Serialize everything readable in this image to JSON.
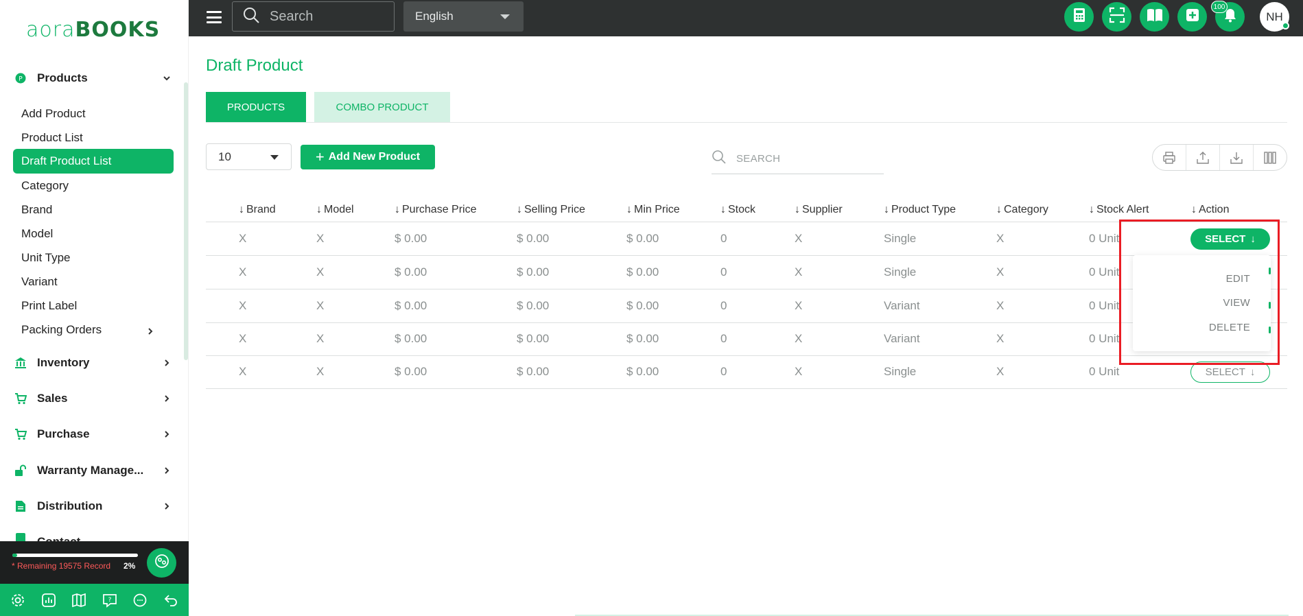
{
  "app": {
    "logo_thin": "aora",
    "logo_bold": "BOOKS"
  },
  "topbar": {
    "search_placeholder": "Search",
    "language": "English",
    "notification_count": "100",
    "user_initials": "NH",
    "icons": [
      "calculator-icon",
      "scan-icon",
      "book-icon",
      "add-icon",
      "bell-icon"
    ]
  },
  "sidebar": {
    "products_label": "Products",
    "product_items": [
      {
        "label": "Add Product"
      },
      {
        "label": "Product List"
      },
      {
        "label": "Draft Product List"
      },
      {
        "label": "Category"
      },
      {
        "label": "Brand"
      },
      {
        "label": "Model"
      },
      {
        "label": "Unit Type"
      },
      {
        "label": "Variant"
      },
      {
        "label": "Print Label"
      },
      {
        "label": "Packing Orders"
      }
    ],
    "active_item": "Draft Product List",
    "groups": [
      {
        "label": "Inventory",
        "icon": "bank-icon"
      },
      {
        "label": "Sales",
        "icon": "cart-icon"
      },
      {
        "label": "Purchase",
        "icon": "cart-icon"
      },
      {
        "label": "Warranty Manage...",
        "icon": "unlock-icon"
      },
      {
        "label": "Distribution",
        "icon": "document-icon"
      },
      {
        "label": "Contact",
        "icon": "contact-icon"
      }
    ],
    "remaining_text": "* Remaining 19575 Record",
    "progress_percent": "2%",
    "progress_value": 0.02,
    "footer_icons": [
      "settings-icon",
      "report-icon",
      "guide-icon",
      "help-icon",
      "chat-icon",
      "logout-icon"
    ]
  },
  "main": {
    "title": "Draft Product",
    "tabs": [
      {
        "label": "PRODUCTS",
        "active": true
      },
      {
        "label": "COMBO PRODUCT",
        "active": false
      }
    ],
    "page_size": "10",
    "add_button": "Add New Product",
    "search_placeholder": "SEARCH",
    "columns": [
      "Brand",
      "Model",
      "Purchase Price",
      "Selling Price",
      "Min Price",
      "Stock",
      "Supplier",
      "Product Type",
      "Category",
      "Stock Alert",
      "Action"
    ],
    "rows": [
      [
        "X",
        "X",
        "$ 0.00",
        "$ 0.00",
        "$ 0.00",
        "0",
        "X",
        "Single",
        "X",
        "0 Unit"
      ],
      [
        "X",
        "X",
        "$ 0.00",
        "$ 0.00",
        "$ 0.00",
        "0",
        "X",
        "Single",
        "X",
        "0 Unit"
      ],
      [
        "X",
        "X",
        "$ 0.00",
        "$ 0.00",
        "$ 0.00",
        "0",
        "X",
        "Variant",
        "X",
        "0 Unit"
      ],
      [
        "X",
        "X",
        "$ 0.00",
        "$ 0.00",
        "$ 0.00",
        "0",
        "X",
        "Variant",
        "X",
        "0 Unit"
      ],
      [
        "X",
        "X",
        "$ 0.00",
        "$ 0.00",
        "$ 0.00",
        "0",
        "X",
        "Single",
        "X",
        "0 Unit"
      ]
    ],
    "select_label": "SELECT",
    "dropdown_items": [
      "EDIT",
      "VIEW",
      "DELETE"
    ]
  },
  "colors": {
    "accent": "#0eb466",
    "topbar": "#2e3131",
    "highlight": "#ea1c24"
  }
}
